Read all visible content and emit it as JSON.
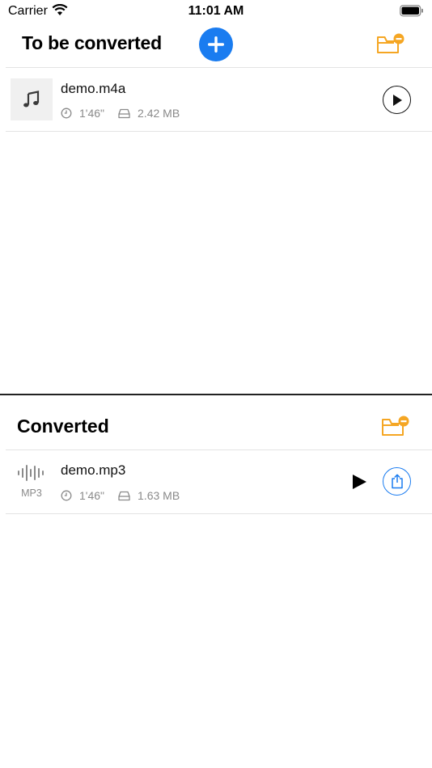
{
  "status_bar": {
    "carrier": "Carrier",
    "time": "11:01 AM"
  },
  "to_convert": {
    "title": "To be converted",
    "items": [
      {
        "name": "demo.m4a",
        "duration": "1'46\"",
        "size": "2.42 MB"
      }
    ]
  },
  "converted": {
    "title": "Converted",
    "items": [
      {
        "name": "demo.mp3",
        "format": "MP3",
        "duration": "1'46\"",
        "size": "1.63 MB"
      }
    ]
  },
  "colors": {
    "accent_blue": "#1a7cf0",
    "folder_orange": "#f5a623",
    "meta_gray": "#8a8a8a"
  },
  "icons": [
    "wifi-icon",
    "battery-icon",
    "plus-icon",
    "folder-remove-icon",
    "music-note-icon",
    "clock-icon",
    "storage-icon",
    "play-icon",
    "waveform-icon",
    "share-icon"
  ]
}
